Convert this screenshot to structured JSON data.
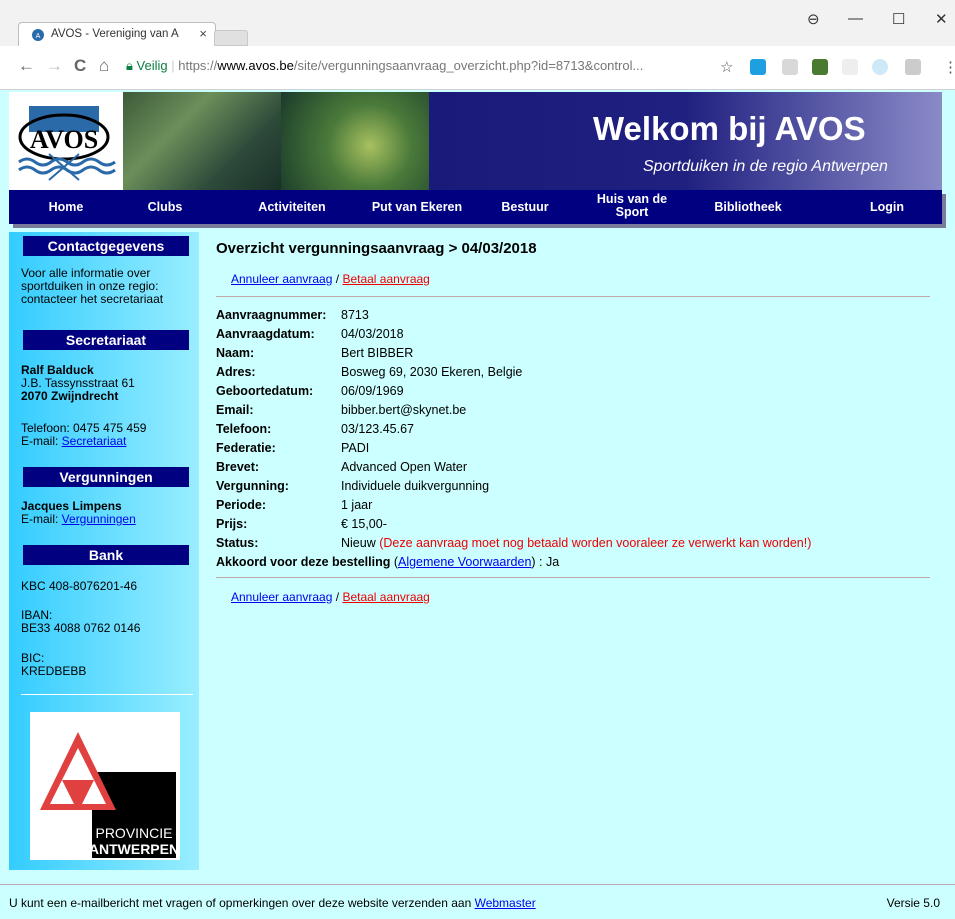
{
  "browser": {
    "tab_title": "AVOS - Vereniging van A",
    "tab_close": "×",
    "window_buttons": {
      "account": "⊖",
      "minimize": "—",
      "maximize": "☐",
      "close": "✕"
    },
    "nav": {
      "back": "←",
      "forward": "→",
      "reload": "C",
      "home": "⌂"
    },
    "secure_label": "Veilig",
    "url_scheme": "https://",
    "url_host": "www.avos.be",
    "url_path": "/site/vergunningsaanvraag_overzicht.php?id=8713&control...",
    "bookmark": "☆",
    "menu": "⋮"
  },
  "banner": {
    "welkom": "Welkom bij AVOS",
    "slogan": "Sportduiken in de regio Antwerpen",
    "logo_text": "AVOS"
  },
  "navbar": {
    "items": [
      "Home",
      "Clubs",
      "Activiteiten",
      "Put van Ekeren",
      "Bestuur",
      "Huis van de Sport",
      "Bibliotheek",
      "Login"
    ]
  },
  "sidebar": {
    "contact_head": "Contactgegevens",
    "contact_text": "Voor alle informatie over sportduiken in onze regio: contacteer het secretariaat",
    "secretariaat_head": "Secretariaat",
    "sec_name": "Ralf Balduck",
    "sec_street": "J.B. Tassynsstraat 61",
    "sec_city": "2070 Zwijndrecht",
    "sec_phone": "Telefoon: 0475 475 459",
    "sec_email_label": "E-mail: ",
    "sec_email_link": "Secretariaat",
    "vergunningen_head": "Vergunningen",
    "verg_name": "Jacques Limpens",
    "verg_email_label": "E-mail: ",
    "verg_email_link": "Vergunningen",
    "bank_head": "Bank",
    "kbc": "KBC 408-8076201-46",
    "iban_label": "IBAN:",
    "iban": "BE33 4088 0762 0146",
    "bic_label": "BIC:",
    "bic": "KREDBEBB",
    "prov_line1": "PROVINCIE",
    "prov_line2": "ANTWERPEN"
  },
  "main": {
    "title": "Overzicht vergunningsaanvraag > 04/03/2018",
    "annuleer": "Annuleer aanvraag",
    "sep": " / ",
    "betaal": "Betaal aanvraag",
    "fields": [
      {
        "label": "Aanvraagnummer:",
        "value": "8713"
      },
      {
        "label": "Aanvraagdatum:",
        "value": "04/03/2018"
      },
      {
        "label": "Naam:",
        "value": "Bert BIBBER"
      },
      {
        "label": "Adres:",
        "value": "Bosweg 69, 2030 Ekeren, Belgie"
      },
      {
        "label": "Geboortedatum:",
        "value": "06/09/1969"
      },
      {
        "label": "Email:",
        "value": "bibber.bert@skynet.be"
      },
      {
        "label": "Telefoon:",
        "value": "03/123.45.67"
      },
      {
        "label": "Federatie:",
        "value": "PADI"
      },
      {
        "label": "Brevet:",
        "value": "Advanced Open Water"
      },
      {
        "label": "Vergunning:",
        "value": "Individuele duikvergunning"
      },
      {
        "label": "Periode:",
        "value": "1 jaar"
      },
      {
        "label": "Prijs:",
        "value": "€ 15,00-"
      }
    ],
    "status_label": "Status:",
    "status_value": "Nieuw ",
    "status_note": "(Deze aanvraag moet nog betaald worden vooraleer ze verwerkt kan worden!)",
    "akkoord_label": "Akkoord voor deze bestelling",
    "akkoord_open": " (",
    "akkoord_link": "Algemene Voorwaarden",
    "akkoord_close": ") : Ja"
  },
  "footer": {
    "text": "U kunt een e-mailbericht met vragen of opmerkingen over deze website verzenden aan ",
    "link": "Webmaster",
    "versie": "Versie 5.0"
  }
}
